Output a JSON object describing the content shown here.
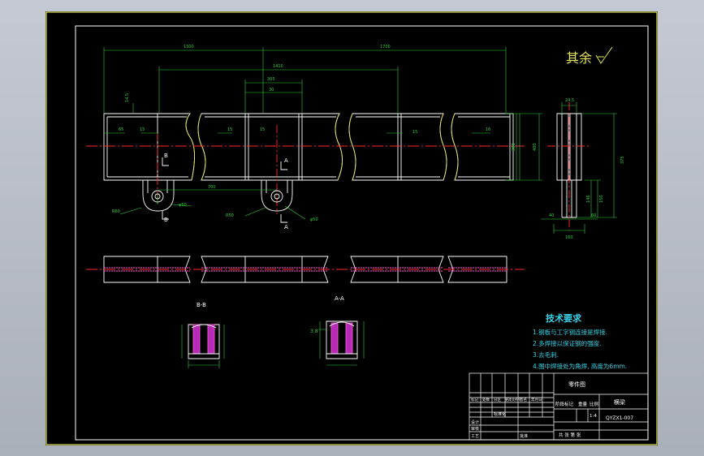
{
  "sheet": {
    "title_block": {
      "part_drawing_label": "零件图",
      "drawing_no": "QYZX1-007",
      "drawing_name": "横梁",
      "scale": "1:4",
      "weight_hdr": "重量",
      "scale_hdr": "比例",
      "stage_label": "阶段标记",
      "sheets_label": "共 张 第 张",
      "approve": "批准",
      "std": "标准化",
      "design": "设计",
      "review": "审核",
      "craft": "工艺",
      "rev": [
        "标记",
        "处数",
        "分区",
        "更改文件号",
        "签名",
        "年月日"
      ]
    },
    "surface_finish": "其余",
    "tech_req": {
      "title": "技术要求",
      "items": [
        "1.钢板与工字钢连接是焊接.",
        "2.多焊接以保证钢的强度.",
        "3.去毛刺.",
        "4.图中焊接处为角焊, 高度为6mm."
      ]
    },
    "section_labels": {
      "bb": "B-B",
      "aa": "A-A",
      "a": "A",
      "b": "B"
    },
    "dims": {
      "d1300": "1300",
      "d1700": "1700",
      "d1410": "1410",
      "d305": "305",
      "d30": "30",
      "d15a": "15",
      "d15b": "15",
      "d15c": "15",
      "d15d": "15",
      "d16": "16",
      "d65": "65",
      "d145": "14.5",
      "d300": "300",
      "d400": "400",
      "d700": "700",
      "dR60": "R60",
      "dR50": "R50",
      "dphi50a": "φ50",
      "dphi50b": "φ50",
      "d245": "24.5",
      "d375": "375",
      "d146": "146",
      "d150": "150",
      "d40": "40",
      "d60": "60",
      "d160": "160",
      "d38": "3.8"
    }
  }
}
